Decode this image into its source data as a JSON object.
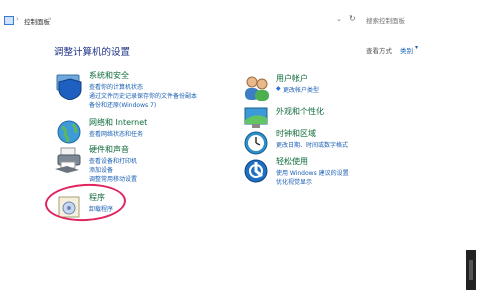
{
  "address_bar": {
    "breadcrumb_root": "控制面板",
    "search_placeholder": "搜索控制面板"
  },
  "header": {
    "title": "调整计算机的设置",
    "view_by_label": "查看方式",
    "view_by_value": "类别"
  },
  "categories_left": [
    {
      "title": "系统和安全",
      "links": [
        "查看你的计算机状态",
        "通过文件历史记录保存你的文件备份副本",
        "备份和还原(Windows 7)"
      ]
    },
    {
      "title": "网络和 Internet",
      "links": [
        "查看网络状态和任务"
      ]
    },
    {
      "title": "硬件和声音",
      "links": [
        "查看设备和打印机",
        "添加设备",
        "调整常用移动设置"
      ]
    },
    {
      "title": "程序",
      "links": [
        "卸载程序"
      ]
    }
  ],
  "categories_right": [
    {
      "title": "用户帐户",
      "links": [
        "更改帐户类型"
      ]
    },
    {
      "title": "外观和个性化",
      "links": []
    },
    {
      "title": "时钟和区域",
      "links": [
        "更改日期、时间或数字格式"
      ]
    },
    {
      "title": "轻松使用",
      "links": [
        "使用 Windows 建议的设置",
        "优化视觉显示"
      ]
    }
  ],
  "colors": {
    "title_accent": "#1e3287",
    "category_green": "#0e6b3a",
    "link_blue": "#1a5fb4",
    "annotation_red": "#e0245e"
  },
  "icons": [
    "folder-icon",
    "refresh-icon",
    "shield-icon",
    "globe-icon",
    "printer-icon",
    "program-icon",
    "users-icon",
    "palette-icon",
    "clock-icon",
    "accessibility-icon"
  ]
}
